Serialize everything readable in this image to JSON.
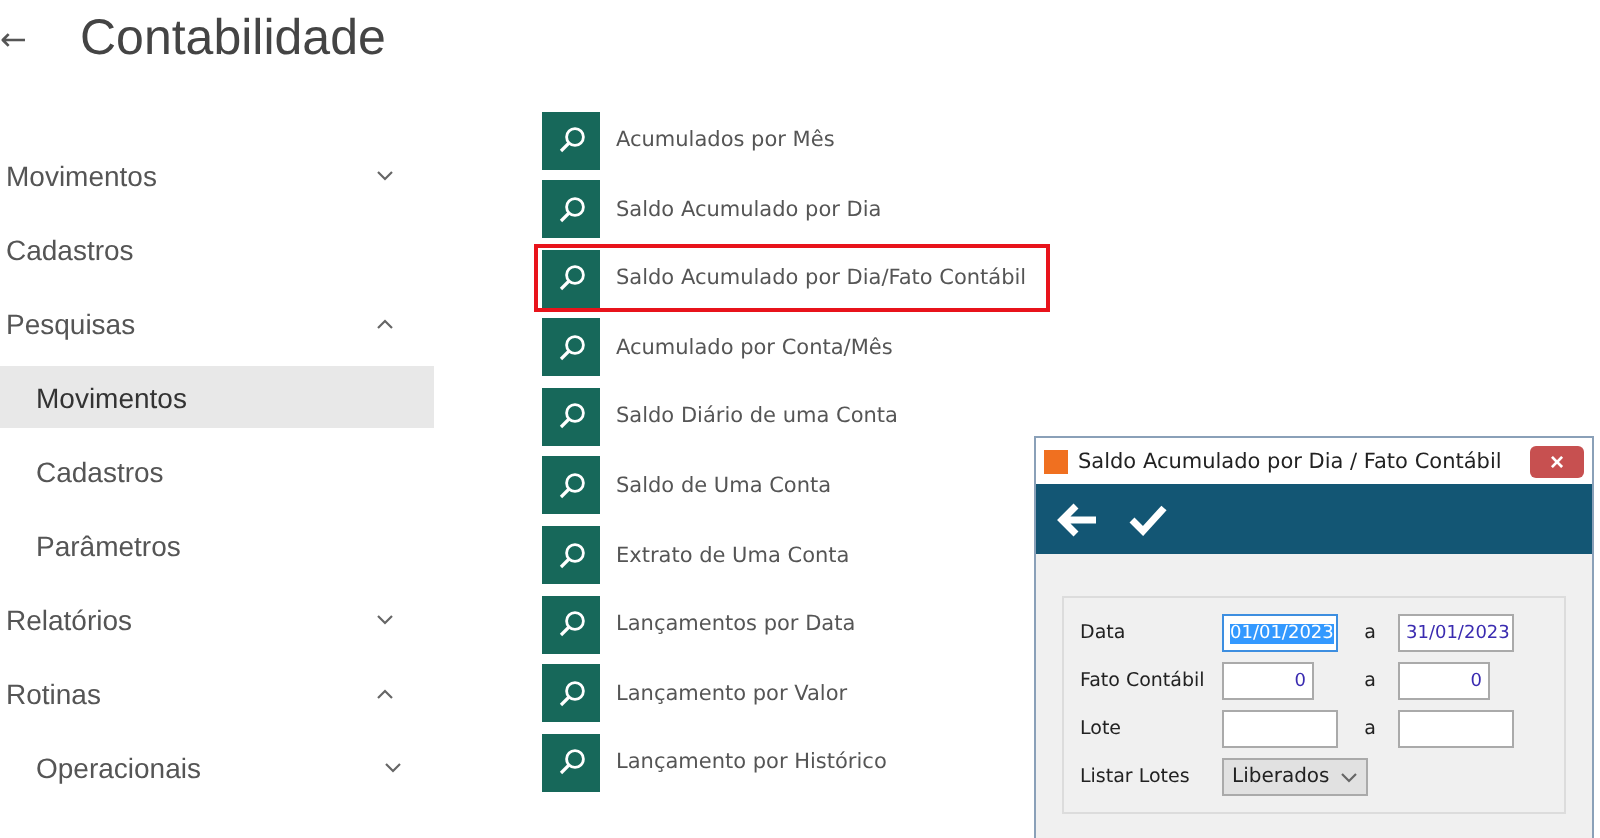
{
  "header": {
    "back": "←",
    "title": "Contabilidade"
  },
  "sidebar": {
    "items": [
      {
        "label": "Movimentos",
        "kind": "group",
        "expanded": false,
        "selected": false
      },
      {
        "label": "Cadastros",
        "kind": "link",
        "selected": false
      },
      {
        "label": "Pesquisas",
        "kind": "group",
        "expanded": true,
        "selected": false,
        "children": [
          {
            "label": "Movimentos",
            "kind": "link",
            "selected": true
          },
          {
            "label": "Cadastros",
            "kind": "link",
            "selected": false
          },
          {
            "label": "Parâmetros",
            "kind": "link",
            "selected": false
          }
        ]
      },
      {
        "label": "Relatórios",
        "kind": "group",
        "expanded": false,
        "selected": false
      },
      {
        "label": "Rotinas",
        "kind": "group",
        "expanded": true,
        "selected": false,
        "children": [
          {
            "label": "Operacionais",
            "kind": "group",
            "expanded": false,
            "selected": false
          }
        ]
      }
    ]
  },
  "searches": [
    {
      "label": "Acumulados por Mês",
      "highlighted": false
    },
    {
      "label": "Saldo Acumulado por Dia",
      "highlighted": false
    },
    {
      "label": "Saldo Acumulado por Dia/Fato Contábil",
      "highlighted": true
    },
    {
      "label": "Acumulado por Conta/Mês",
      "highlighted": false
    },
    {
      "label": "Saldo Diário de uma Conta",
      "highlighted": false
    },
    {
      "label": "Saldo de Uma Conta",
      "highlighted": false
    },
    {
      "label": "Extrato de Uma Conta",
      "highlighted": false
    },
    {
      "label": "Lançamentos por Data",
      "highlighted": false
    },
    {
      "label": "Lançamento por Valor",
      "highlighted": false
    },
    {
      "label": "Lançamento por Histórico",
      "highlighted": false
    }
  ],
  "dialog": {
    "title": "Saldo Acumulado por Dia / Fato Contábil",
    "close": "×",
    "rows": [
      {
        "label": "Data",
        "kind": "range",
        "from": {
          "value": "01/01/2023",
          "focused": true
        },
        "sep": "a",
        "to": {
          "value": "31/01/2023",
          "focused": false
        }
      },
      {
        "label": "Fato Contábil",
        "kind": "range",
        "from": {
          "value": "0",
          "focused": false
        },
        "sep": "a",
        "to": {
          "value": "0",
          "focused": false
        }
      },
      {
        "label": "Lote",
        "kind": "range",
        "from": {
          "focused": false
        },
        "sep": "a",
        "to": {
          "focused": false
        }
      },
      {
        "label": "Listar Lotes",
        "kind": "select",
        "value": "Liberados"
      }
    ]
  }
}
